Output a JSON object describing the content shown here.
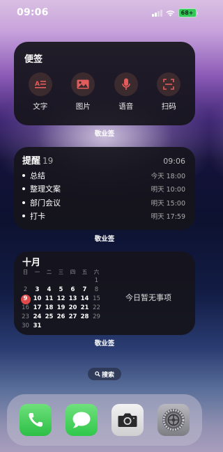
{
  "status_bar": {
    "time": "09:06",
    "battery": "68+"
  },
  "notes_widget": {
    "title": "便签",
    "actions": [
      {
        "label": "文字",
        "icon": "text-icon"
      },
      {
        "label": "图片",
        "icon": "image-icon"
      },
      {
        "label": "语音",
        "icon": "microphone-icon"
      },
      {
        "label": "扫码",
        "icon": "scan-icon"
      }
    ],
    "caption": "敬业签"
  },
  "reminder_widget": {
    "title": "提醒",
    "count": "19",
    "time": "09:06",
    "items": [
      {
        "text": "总结",
        "due": "今天 18:00"
      },
      {
        "text": "整理文案",
        "due": "明天 10:00"
      },
      {
        "text": "部门会议",
        "due": "明天 15:00"
      },
      {
        "text": "打卡",
        "due": "明天 17:59"
      }
    ],
    "caption": "敬业签"
  },
  "calendar_widget": {
    "month": "十月",
    "weekdays": [
      "日",
      "一",
      "二",
      "三",
      "四",
      "五",
      "六"
    ],
    "weeks": [
      [
        "",
        "",
        "",
        "",
        "",
        "",
        "1"
      ],
      [
        "2",
        "3",
        "4",
        "5",
        "6",
        "7",
        "8"
      ],
      [
        "9",
        "10",
        "11",
        "12",
        "13",
        "14",
        "15"
      ],
      [
        "16",
        "17",
        "18",
        "19",
        "20",
        "21",
        "22"
      ],
      [
        "23",
        "24",
        "25",
        "26",
        "27",
        "28",
        "29"
      ],
      [
        "30",
        "31",
        "",
        "",
        "",
        "",
        ""
      ]
    ],
    "today": "9",
    "empty_text": "今日暂无事项",
    "caption": "敬业签"
  },
  "search": {
    "label": "搜索"
  },
  "dock": {
    "apps": [
      {
        "name": "phone",
        "icon": "phone-icon"
      },
      {
        "name": "messages",
        "icon": "message-icon"
      },
      {
        "name": "camera",
        "icon": "camera-icon"
      },
      {
        "name": "settings",
        "icon": "gear-icon"
      }
    ]
  },
  "colors": {
    "accent_red": "#e04a4a",
    "icon_red": "#e25c5c",
    "dock_green": "#2cbf45"
  }
}
